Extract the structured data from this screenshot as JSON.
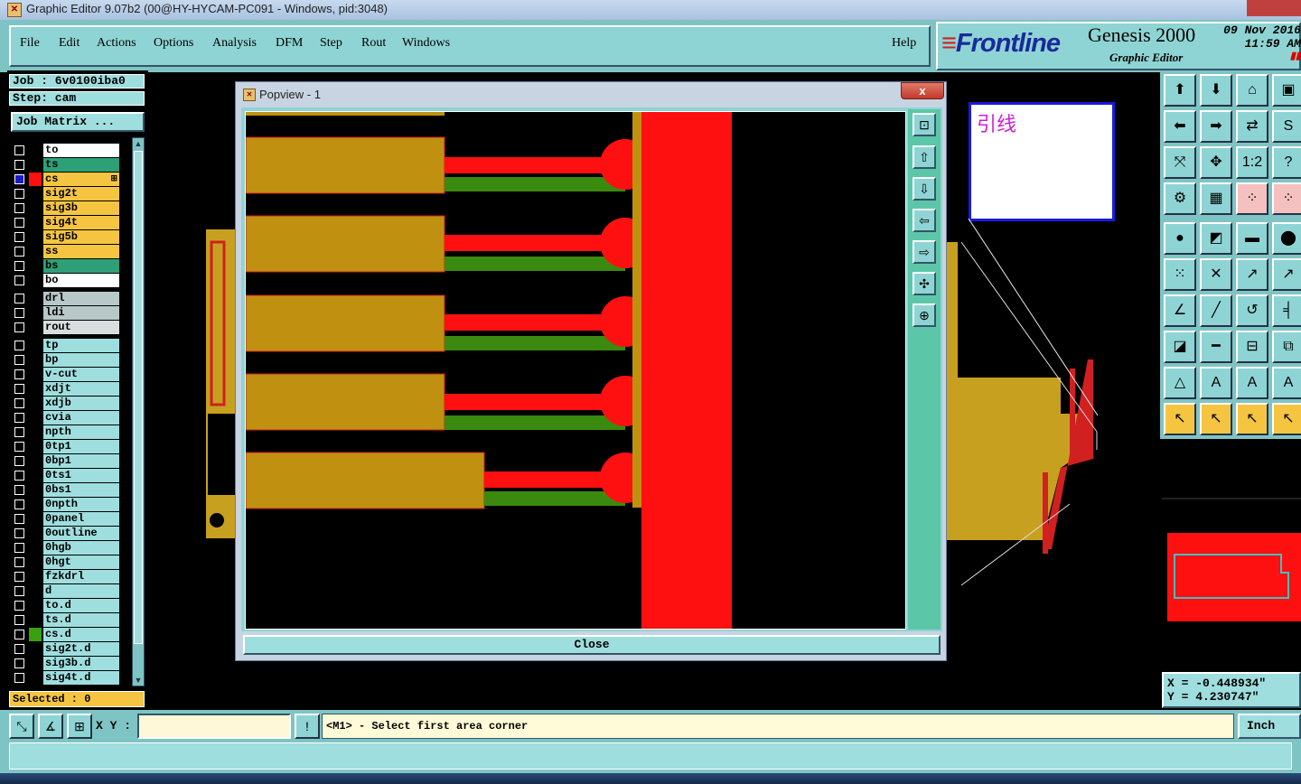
{
  "window": {
    "title": "Graphic Editor 9.07b2 (00@HY-HYCAM-PC091 - Windows, pid:3048)"
  },
  "menu": {
    "items": [
      "File",
      "Edit",
      "Actions",
      "Options",
      "Analysis",
      "DFM",
      "Step",
      "Rout",
      "Windows"
    ],
    "help": "Help"
  },
  "brand": {
    "logo": "Frontline",
    "product": "Genesis 2000",
    "subtitle": "Graphic Editor",
    "date": "09 Nov 2016",
    "time": "11:59 AM"
  },
  "job": {
    "job_label": "Job : 6v0100iba0",
    "step_label": "Step: cam",
    "matrix_button": "Job Matrix ..."
  },
  "layers": [
    {
      "name": "to",
      "color": "#ffffff",
      "checked": false
    },
    {
      "name": "ts",
      "color": "#2ea078",
      "checked": false
    },
    {
      "name": "cs",
      "color": "#f5c542",
      "checked": true,
      "marker": "⊞"
    },
    {
      "name": "sig2t",
      "color": "#f5c542",
      "checked": false
    },
    {
      "name": "sig3b",
      "color": "#f5c542",
      "checked": false
    },
    {
      "name": "sig4t",
      "color": "#f5c542",
      "checked": false
    },
    {
      "name": "sig5b",
      "color": "#f5c542",
      "checked": false
    },
    {
      "name": "ss",
      "color": "#f5c542",
      "checked": false
    },
    {
      "name": "bs",
      "color": "#2ea078",
      "checked": false
    },
    {
      "name": "bo",
      "color": "#ffffff",
      "checked": false
    },
    {
      "name": "drl",
      "color": "#b8c8c8",
      "checked": false
    },
    {
      "name": "ldi",
      "color": "#b8c8c8",
      "checked": false
    },
    {
      "name": "rout",
      "color": "#d8dede",
      "checked": false
    },
    {
      "name": "tp",
      "color": "#9fdede",
      "checked": false
    },
    {
      "name": "bp",
      "color": "#9fdede",
      "checked": false
    },
    {
      "name": "v-cut",
      "color": "#9fdede",
      "checked": false
    },
    {
      "name": "xdjt",
      "color": "#9fdede",
      "checked": false
    },
    {
      "name": "xdjb",
      "color": "#9fdede",
      "checked": false
    },
    {
      "name": "cvia",
      "color": "#9fdede",
      "checked": false
    },
    {
      "name": "npth",
      "color": "#9fdede",
      "checked": false
    },
    {
      "name": "0tp1",
      "color": "#9fdede",
      "checked": false
    },
    {
      "name": "0bp1",
      "color": "#9fdede",
      "checked": false
    },
    {
      "name": "0ts1",
      "color": "#9fdede",
      "checked": false
    },
    {
      "name": "0bs1",
      "color": "#9fdede",
      "checked": false
    },
    {
      "name": "0npth",
      "color": "#9fdede",
      "checked": false
    },
    {
      "name": "0panel",
      "color": "#9fdede",
      "checked": false
    },
    {
      "name": "0outline",
      "color": "#9fdede",
      "checked": false
    },
    {
      "name": "0hgb",
      "color": "#9fdede",
      "checked": false
    },
    {
      "name": "0hgt",
      "color": "#9fdede",
      "checked": false
    },
    {
      "name": "fzkdrl",
      "color": "#9fdede",
      "checked": false
    },
    {
      "name": "d",
      "color": "#9fdede",
      "checked": false
    },
    {
      "name": "to.d",
      "color": "#9fdede",
      "checked": false
    },
    {
      "name": "ts.d",
      "color": "#9fdede",
      "checked": false
    },
    {
      "name": "cs.d",
      "color": "#9fdede",
      "checked": false
    },
    {
      "name": "sig2t.d",
      "color": "#9fdede",
      "checked": false
    },
    {
      "name": "sig3b.d",
      "color": "#9fdede",
      "checked": false
    },
    {
      "name": "sig4t.d",
      "color": "#9fdede",
      "checked": false
    }
  ],
  "selected": "Selected : 0",
  "popview": {
    "title": "Popview - 1",
    "close_x": "x",
    "close_button": "Close"
  },
  "annotation": {
    "text": "引线"
  },
  "coords": {
    "x": "X = -0.448934\"",
    "y": "Y = 4.230747\""
  },
  "bottom": {
    "xy_label": "X Y :",
    "xy_value": "",
    "prompt": "<M1> - Select first area corner",
    "unit": "Inch"
  }
}
